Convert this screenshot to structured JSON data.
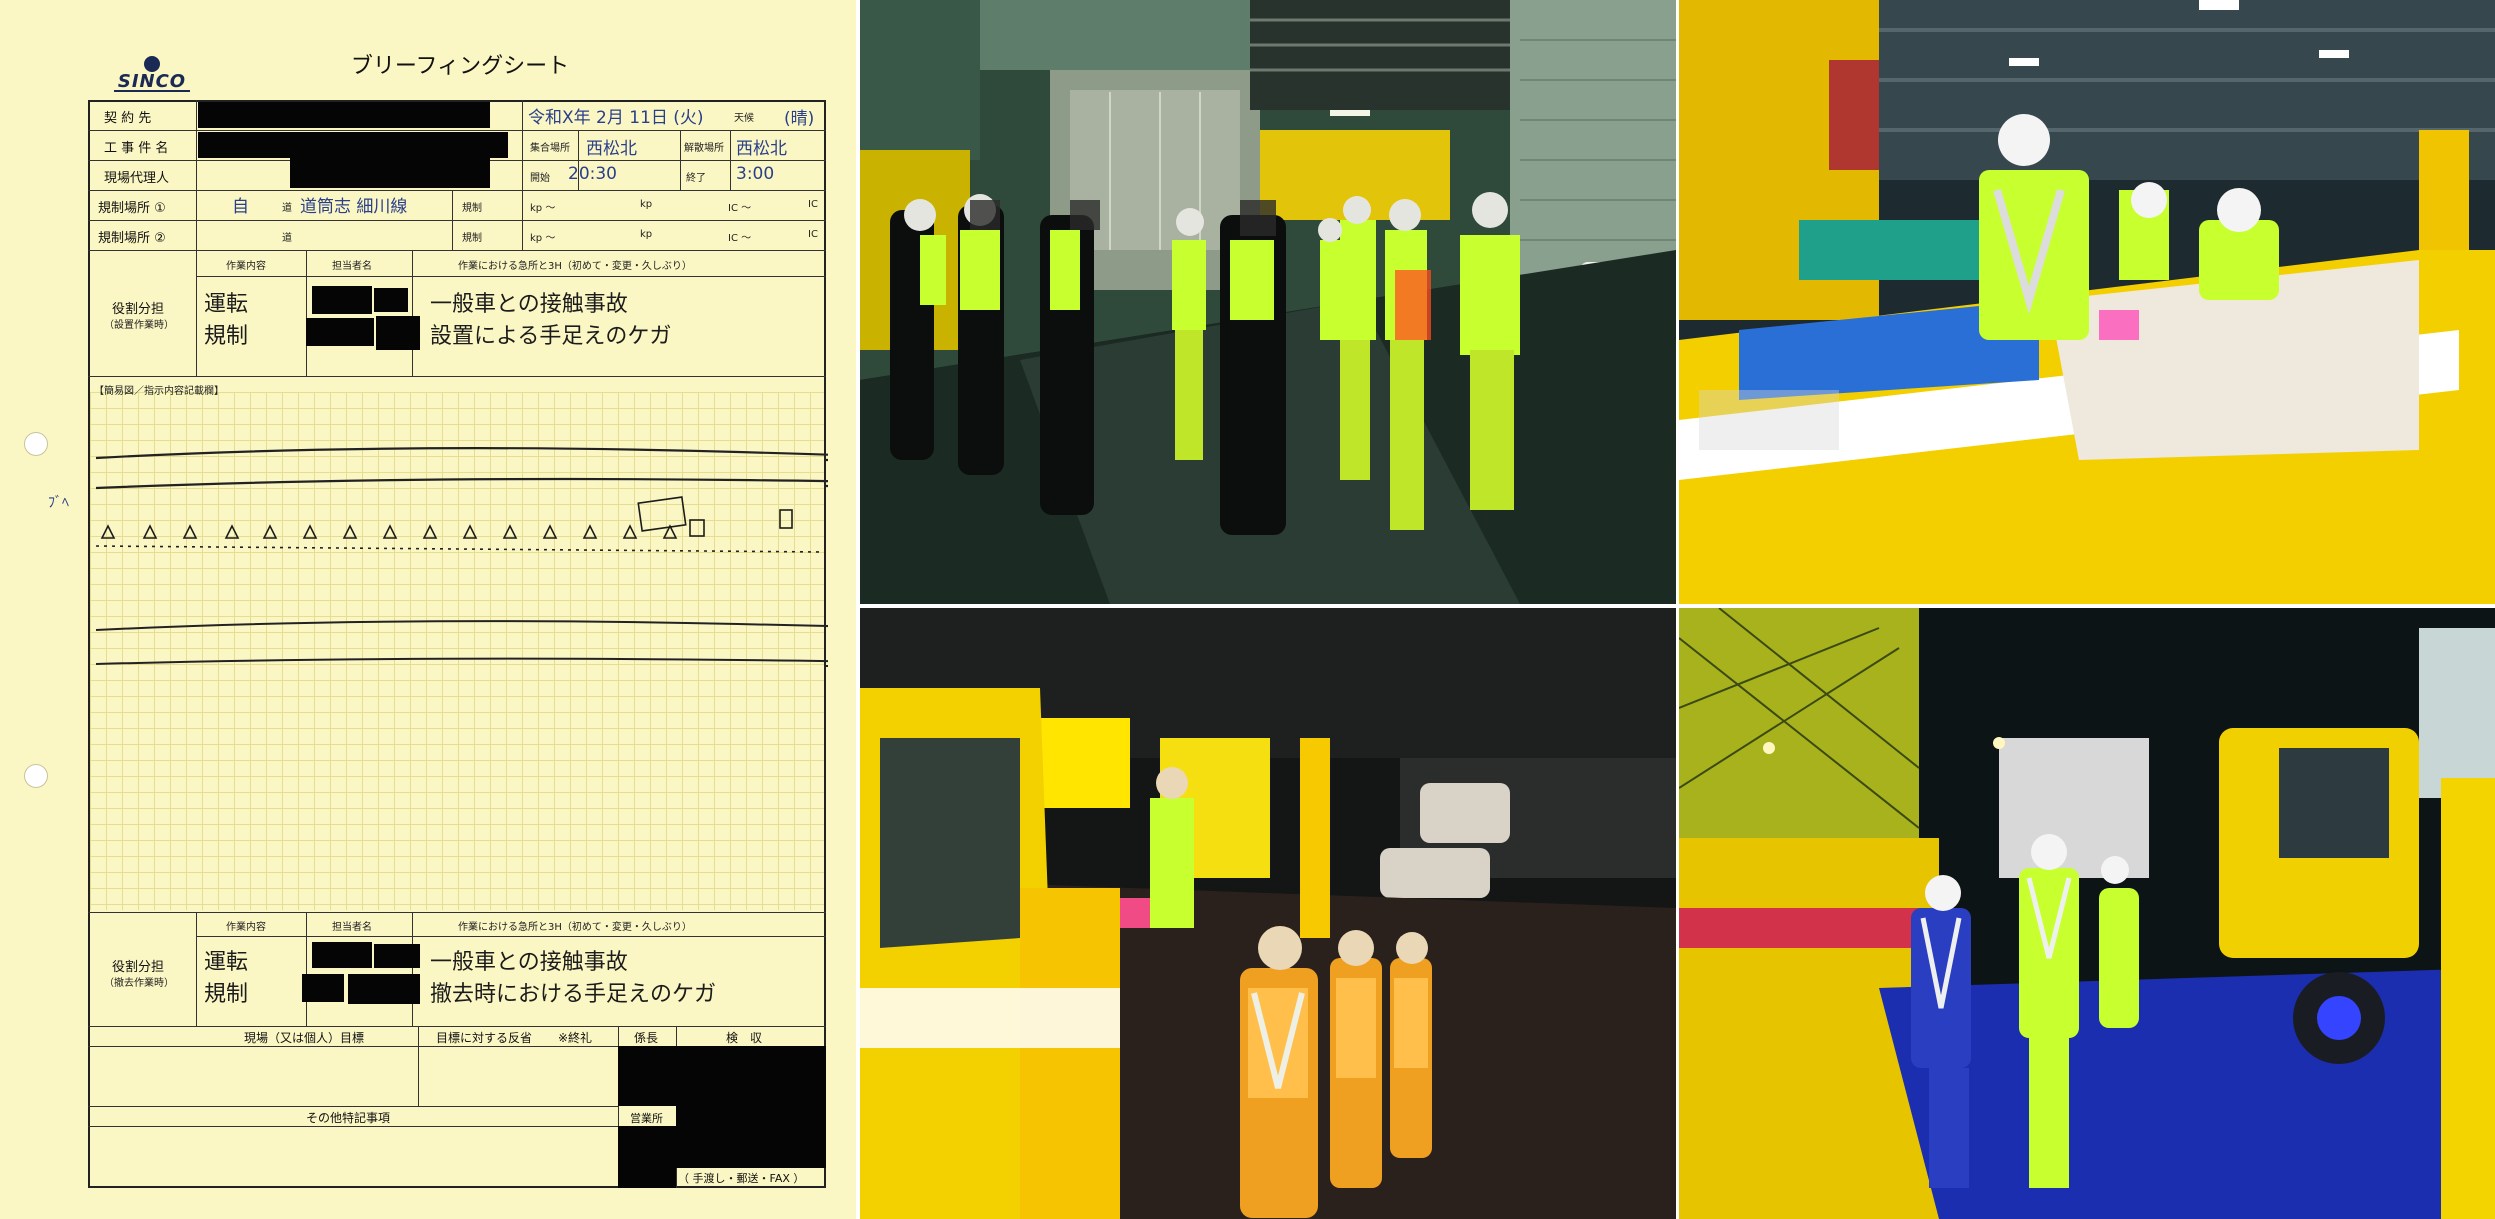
{
  "sheet": {
    "logo": "SINCO",
    "title": "ブリーフィングシート",
    "rows": {
      "contractor": "契 約 先",
      "project": "工 事 件 名",
      "agent": "現場代理人",
      "site1": "規制場所 ①",
      "site2": "規制場所 ②"
    },
    "header_fields": {
      "date_label": "令和 年 月 日",
      "date_value": "令和X年 2月 11日 (火)",
      "weather": "天候",
      "weather_value": "(晴)",
      "assembly_place": "集合場所",
      "assembly_value": "西松北",
      "dismiss_place": "解散場所",
      "dismiss_value": "西松北",
      "start_label": "開始",
      "start_value": "20:30",
      "end_label": "終了",
      "end_value": "3:00",
      "road1": "道",
      "road1_value": "自",
      "road1_name": "道筒志 細川線",
      "road2": "道",
      "regulate": "規制",
      "kp1": "kp ～",
      "kp2": "kp",
      "ic1": "IC ～",
      "ic2": "IC"
    },
    "setup": {
      "section_label": "役割分担",
      "section_sub": "（設置作業時）",
      "col_work": "作業内容",
      "col_person": "担当者名",
      "col_risk": "作業における急所と3H（初めて・変更・久しぶり）",
      "work_lines": [
        "運転",
        "規制"
      ],
      "risk_lines": [
        "一般車との接触事故",
        "設置による手足えのケガ"
      ]
    },
    "sketch_title": "【簡易図／指示内容記載欄】",
    "sketch_mark": "ﾌﾞﾍ",
    "removal": {
      "section_label": "役割分担",
      "section_sub": "（撤去作業時）",
      "col_work": "作業内容",
      "col_person": "担当者名",
      "col_risk": "作業における急所と3H（初めて・変更・久しぶり）",
      "work_lines": [
        "運転",
        "規制"
      ],
      "risk_lines": [
        "一般車との接触事故",
        "撤去時における手足えのケガ"
      ]
    },
    "footer": {
      "goal": "現場（又は個人）目標",
      "reflection": "目標に対する反省",
      "end_note": "※終礼",
      "chief": "係長",
      "inspection": "検　収",
      "other_notes": "その他特記事項",
      "sales": "営業所",
      "delivery": "（ 手渡し・郵送・FAX ）"
    }
  },
  "photos": [
    {
      "id": "briefing-garage"
    },
    {
      "id": "truck-bed-check"
    },
    {
      "id": "truck-roll-call-orange"
    },
    {
      "id": "truck-inspection-blue"
    }
  ],
  "colors": {
    "paper": "#fbf7c4",
    "vest": "#c8ff2e",
    "truck_yellow": "#f2d400",
    "redaction": "#050505"
  }
}
